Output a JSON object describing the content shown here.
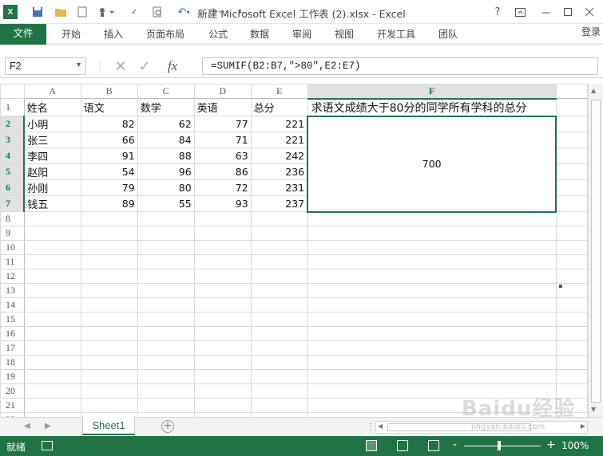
{
  "window": {
    "title": "新建 Microsoft Excel 工作表 (2).xlsx - Excel",
    "help": "?",
    "signin": "登录"
  },
  "ribbon": {
    "tabs": [
      "文件",
      "开始",
      "插入",
      "页面布局",
      "公式",
      "数据",
      "审阅",
      "视图",
      "开发工具",
      "团队"
    ]
  },
  "formula_bar": {
    "name_box": "F2",
    "fx": "fx",
    "formula": "=SUMIF(B2:B7,\">80\",E2:E7)"
  },
  "sheet": {
    "columns": [
      "A",
      "B",
      "C",
      "D",
      "E",
      "F"
    ],
    "rows": [
      "1",
      "2",
      "3",
      "4",
      "5",
      "6",
      "7",
      "8",
      "9",
      "10",
      "11",
      "12",
      "13",
      "14",
      "15",
      "16",
      "17",
      "18",
      "19",
      "20",
      "21",
      "22"
    ],
    "header_row": [
      "姓名",
      "语文",
      "数学",
      "英语",
      "总分",
      "求语文成绩大于80分的同学所有学科的总分"
    ],
    "data": [
      [
        "小明",
        "82",
        "62",
        "77",
        "221"
      ],
      [
        "张三",
        "66",
        "84",
        "71",
        "221"
      ],
      [
        "李四",
        "91",
        "88",
        "63",
        "242"
      ],
      [
        "赵阳",
        "54",
        "96",
        "86",
        "236"
      ],
      [
        "孙刚",
        "79",
        "80",
        "72",
        "231"
      ],
      [
        "钱五",
        "89",
        "55",
        "93",
        "237"
      ]
    ],
    "result": "700",
    "selected_cell": "F2"
  },
  "sheet_tabs": {
    "active": "Sheet1",
    "add_label": "+"
  },
  "status_bar": {
    "status": "就绪",
    "zoom": "100%",
    "zoom_minus": "-",
    "zoom_plus": "+"
  },
  "watermark": {
    "brand": "Baidu经验",
    "url": "jingyan.baidu.com"
  },
  "colors": {
    "accent": "#217346"
  }
}
